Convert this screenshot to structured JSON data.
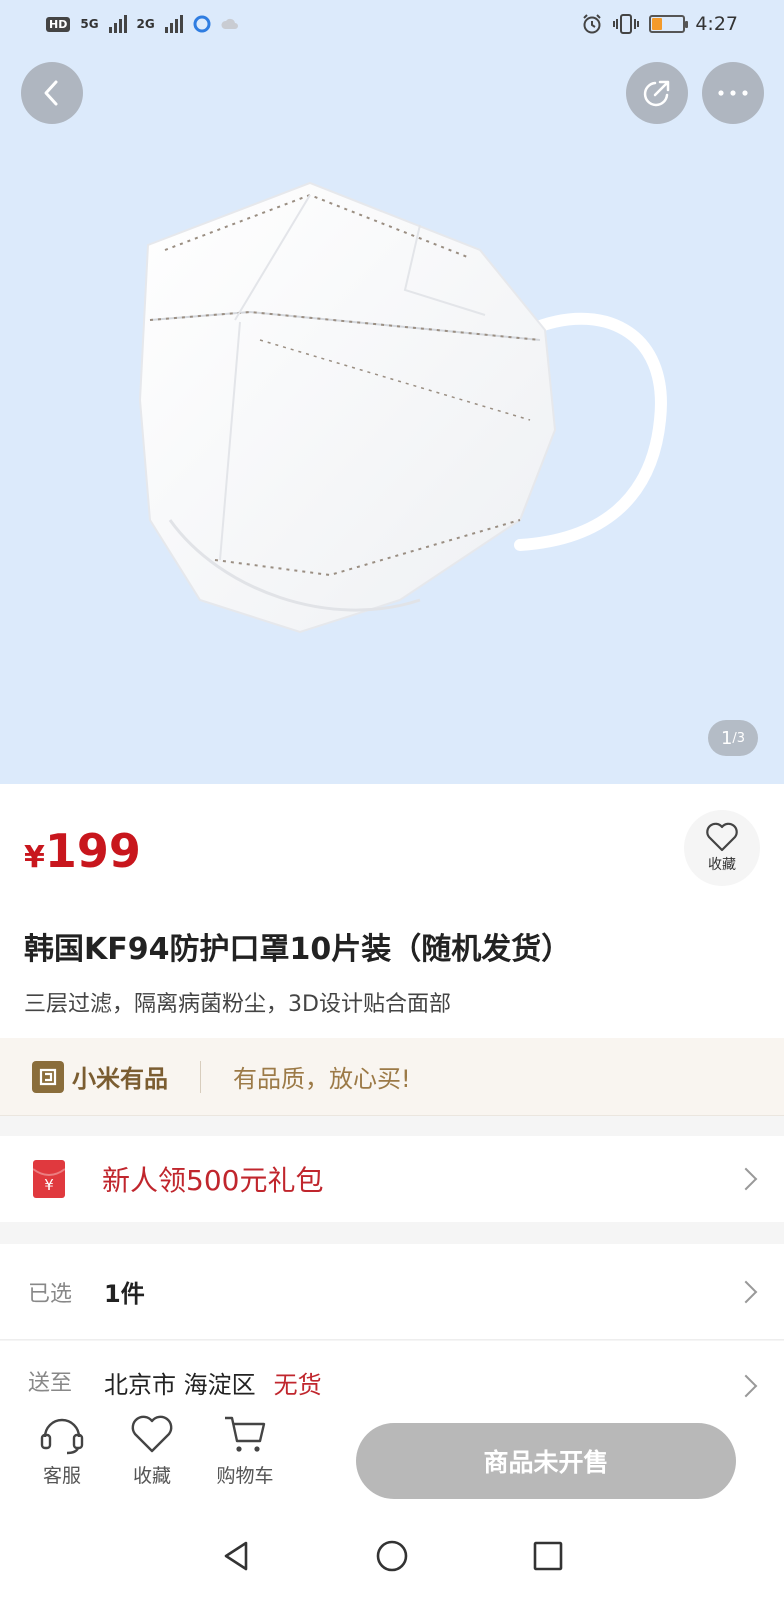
{
  "status_bar": {
    "hd_label": "HD",
    "net_1": "5G",
    "net_2": "2G",
    "time": "4:27",
    "battery_level": 0.3
  },
  "gallery": {
    "counter_current": "1",
    "counter_total": "/3"
  },
  "product": {
    "currency": "¥",
    "price": "199",
    "favorite_label": "收藏",
    "title": "韩国KF94防护口罩10片装（随机发货）",
    "subtitle": "三层过滤，隔离病菌粉尘，3D设计贴合面部"
  },
  "brand": {
    "name": "小米有品",
    "slogan": "有品质，放心买!"
  },
  "coupon": {
    "text": "新人领500元礼包",
    "icon_glyph": "¥"
  },
  "selection": {
    "label": "已选",
    "value": "1件"
  },
  "shipping": {
    "label": "送至",
    "address": "北京市 海淀区",
    "stock": "无货"
  },
  "actions": {
    "service_label": "客服",
    "favorite_label": "收藏",
    "cart_label": "购物车",
    "buy_label": "商品未开售"
  },
  "colors": {
    "price_red": "#c8161d",
    "hero_bg": "#dceafb",
    "disabled_button": "#b8b8b8"
  }
}
